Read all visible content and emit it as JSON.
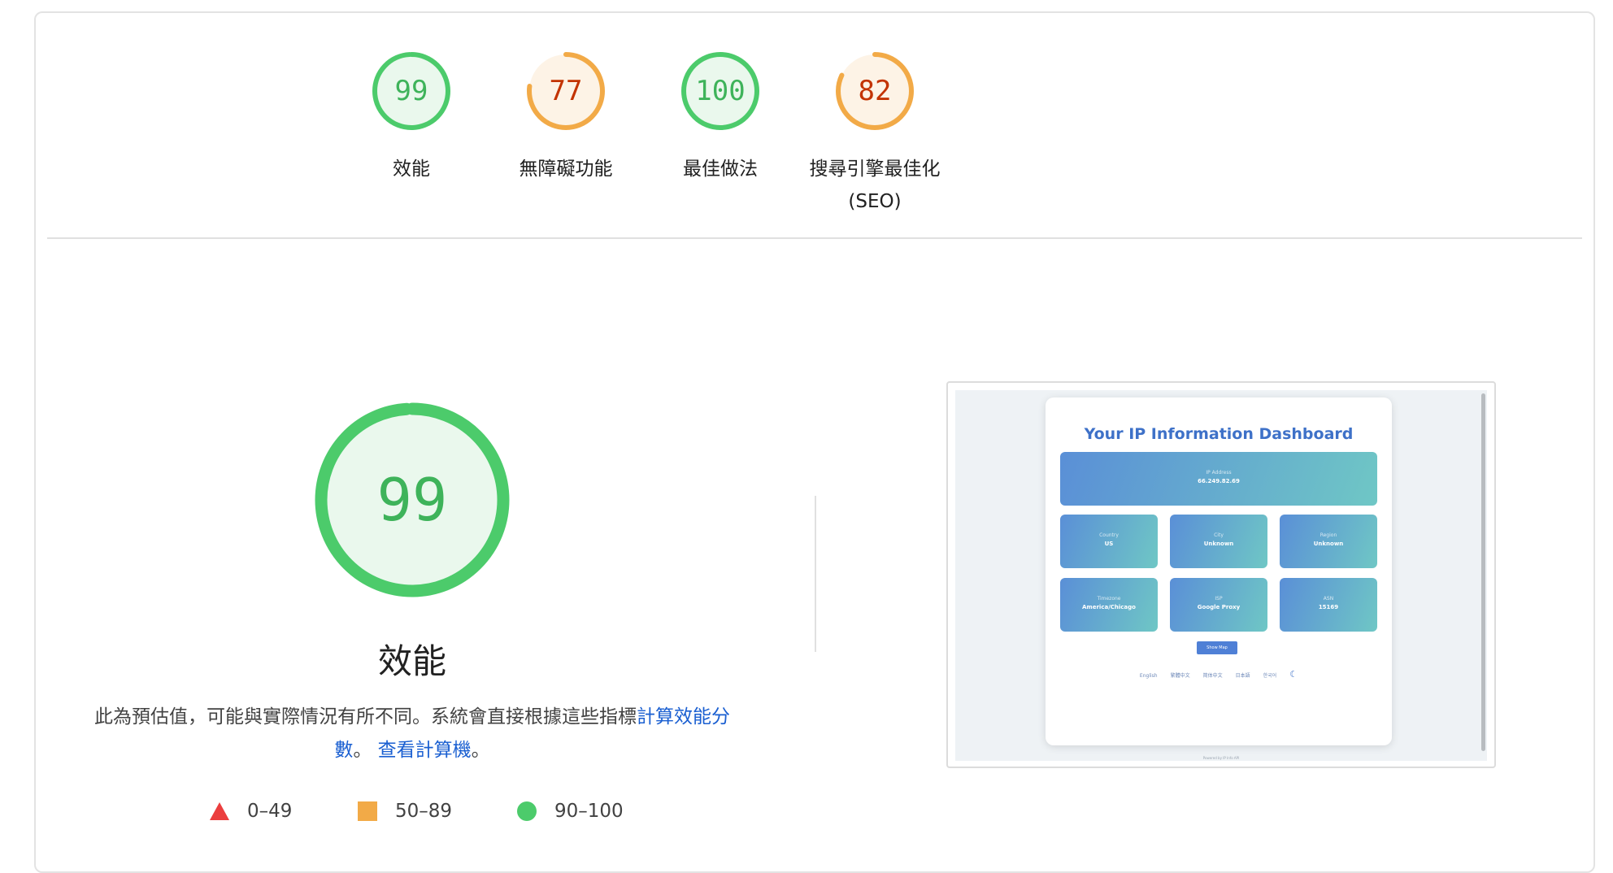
{
  "summary": {
    "gauges": [
      {
        "score": "99",
        "label": "效能",
        "value": 99,
        "color": "#3eb35a",
        "ring": "#4ccb6b",
        "fill": "#eaf8ed"
      },
      {
        "score": "77",
        "label": "無障礙功能",
        "value": 77,
        "color": "#c33300",
        "ring": "#f2aa47",
        "fill": "#fdf3e6"
      },
      {
        "score": "100",
        "label": "最佳做法",
        "value": 100,
        "color": "#3eb35a",
        "ring": "#4ccb6b",
        "fill": "#eaf8ed"
      },
      {
        "score": "82",
        "label": "搜尋引擎最佳化",
        "label2": "(SEO)",
        "value": 82,
        "color": "#c33300",
        "ring": "#f2aa47",
        "fill": "#fdf3e6"
      }
    ]
  },
  "detail": {
    "score": "99",
    "value": 99,
    "title": "效能",
    "description_prefix": "此為預估值，可能與實際情況有所不同。系統會直接根據這些指標",
    "link_calc": "計算效能分數",
    "sep": "。",
    "link_calculator": "查看計算機",
    "end": "。"
  },
  "legend": {
    "fail": "0–49",
    "average": "50–89",
    "pass": "90–100"
  },
  "screenshot": {
    "title": "Your IP Information Dashboard",
    "ip_label": "IP Address",
    "ip_value": "66.249.82.69",
    "tiles": [
      {
        "label": "Country",
        "value": "US"
      },
      {
        "label": "City",
        "value": "Unknown"
      },
      {
        "label": "Region",
        "value": "Unknown"
      },
      {
        "label": "Timezone",
        "value": "America/Chicago"
      },
      {
        "label": "ISP",
        "value": "Google Proxy"
      },
      {
        "label": "ASN",
        "value": "15169"
      }
    ],
    "map_button": "Show Map",
    "languages": [
      "English",
      "繁體中文",
      "简体中文",
      "日本語",
      "한국어"
    ],
    "footer": "Powered by IP Info API"
  }
}
